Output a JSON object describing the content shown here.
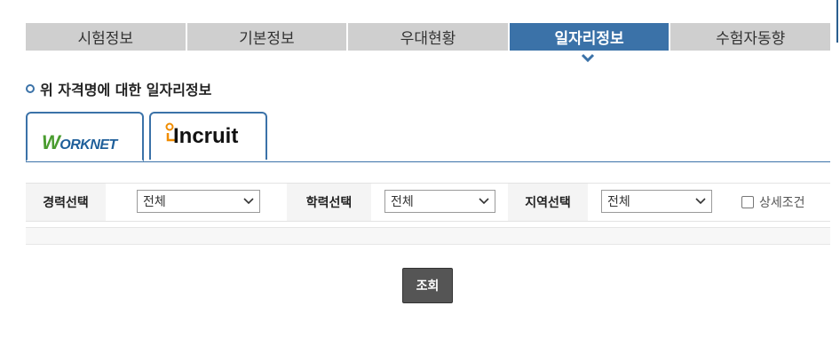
{
  "tabs": [
    {
      "label": "시험정보",
      "active": false
    },
    {
      "label": "기본정보",
      "active": false
    },
    {
      "label": "우대현황",
      "active": false
    },
    {
      "label": "일자리정보",
      "active": true
    },
    {
      "label": "수험자동향",
      "active": false
    }
  ],
  "section_title": "위 자격명에 대한 일자리정보",
  "sources": {
    "worknet": {
      "label": "WORKNET",
      "selected": true
    },
    "incruit": {
      "label": "Incruit",
      "selected": false
    }
  },
  "filters": {
    "career": {
      "label": "경력선택",
      "value": "전체"
    },
    "education": {
      "label": "학력선택",
      "value": "전체"
    },
    "region": {
      "label": "지역선택",
      "value": "전체"
    },
    "detail": {
      "label": "상세조건",
      "checked": false
    }
  },
  "search_button": "조회",
  "colors": {
    "accent": "#3b72a8",
    "tab_inactive": "#cfcfcf",
    "button": "#555555"
  }
}
